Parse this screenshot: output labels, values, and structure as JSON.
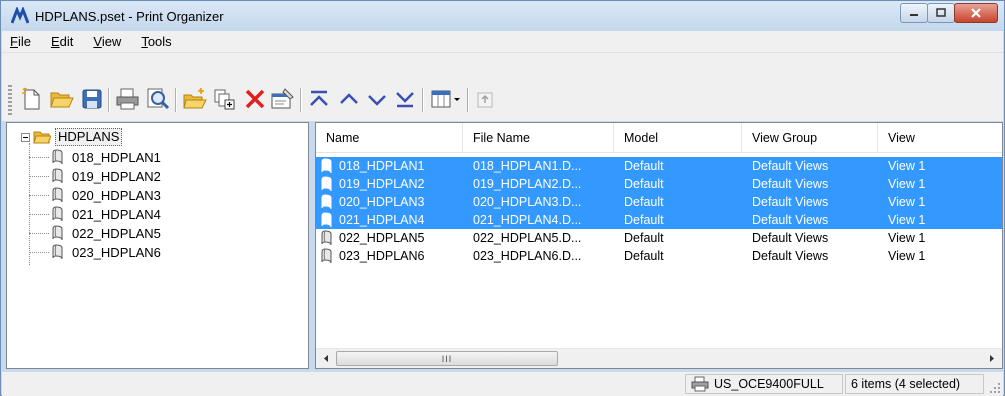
{
  "window": {
    "title": "HDPLANS.pset - Print Organizer"
  },
  "menu": [
    {
      "label": "File",
      "accel": "F",
      "rest": "ile"
    },
    {
      "label": "Edit",
      "accel": "E",
      "rest": "dit"
    },
    {
      "label": "View",
      "accel": "V",
      "rest": "iew"
    },
    {
      "label": "Tools",
      "accel": "T",
      "rest": "ools"
    }
  ],
  "toolbar": {
    "buttons": [
      "new-icon",
      "open-folder-icon",
      "save-icon",
      "print-icon",
      "print-preview-icon",
      "add-folder-icon",
      "add-files-icon",
      "delete-icon",
      "properties-icon",
      "move-to-top-icon",
      "move-up-icon",
      "move-down-icon",
      "move-to-bottom-icon",
      "columns-view-icon",
      "export-icon"
    ]
  },
  "tree": {
    "root_label": "HDPLANS",
    "items": [
      "018_HDPLAN1",
      "019_HDPLAN2",
      "020_HDPLAN3",
      "021_HDPLAN4",
      "022_HDPLAN5",
      "023_HDPLAN6"
    ]
  },
  "list": {
    "columns": [
      "Name",
      "File Name",
      "Model",
      "View Group",
      "View"
    ],
    "rows": [
      {
        "name": "018_HDPLAN1",
        "file": "018_HDPLAN1.D...",
        "model": "Default",
        "group": "Default Views",
        "view": "View 1",
        "selected": true
      },
      {
        "name": "019_HDPLAN2",
        "file": "019_HDPLAN2.D...",
        "model": "Default",
        "group": "Default Views",
        "view": "View 1",
        "selected": true
      },
      {
        "name": "020_HDPLAN3",
        "file": "020_HDPLAN3.D...",
        "model": "Default",
        "group": "Default Views",
        "view": "View 1",
        "selected": true
      },
      {
        "name": "021_HDPLAN4",
        "file": "021_HDPLAN4.D...",
        "model": "Default",
        "group": "Default Views",
        "view": "View 1",
        "selected": true
      },
      {
        "name": "022_HDPLAN5",
        "file": "022_HDPLAN5.D...",
        "model": "Default",
        "group": "Default Views",
        "view": "View 1",
        "selected": false
      },
      {
        "name": "023_HDPLAN6",
        "file": "023_HDPLAN6.D...",
        "model": "Default",
        "group": "Default Views",
        "view": "View 1",
        "selected": false
      }
    ],
    "selection_color": "#3399ff",
    "scroll_grip": "III"
  },
  "status": {
    "printer": "US_OCE9400FULL",
    "count": "6 items (4 selected)"
  }
}
